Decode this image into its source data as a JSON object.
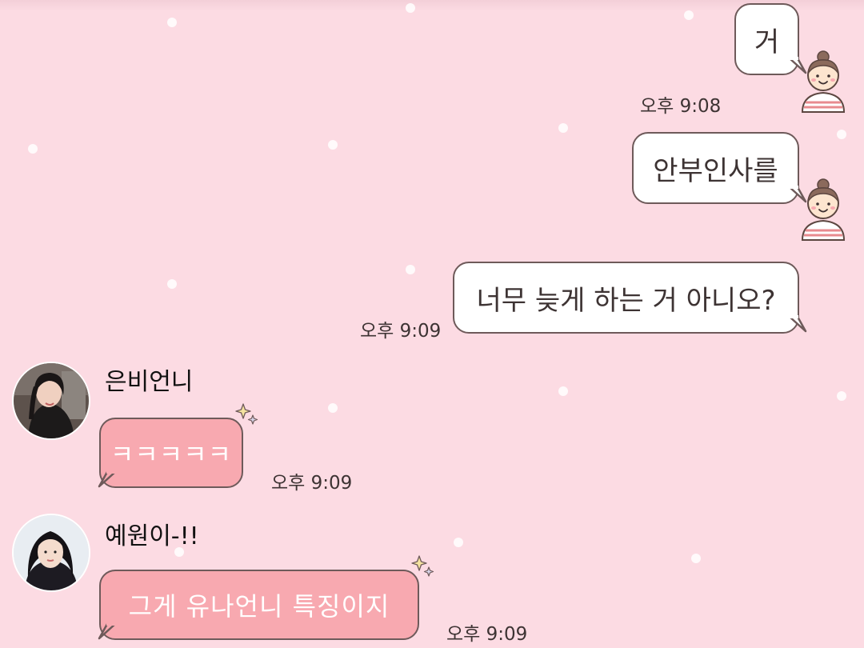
{
  "colors": {
    "background": "#fcdbe3",
    "outgoing_bubble": "#ffffff",
    "incoming_bubble": "#f8a9b0",
    "bubble_border": "#6e5a5a"
  },
  "messages": [
    {
      "direction": "outgoing",
      "text": "거",
      "time": "오후 9:08"
    },
    {
      "direction": "outgoing",
      "text": "안부인사를",
      "time": ""
    },
    {
      "direction": "outgoing",
      "text": "너무 늦게 하는 거 아니오?",
      "time": "오후 9:09"
    },
    {
      "direction": "incoming",
      "sender": "은비언니",
      "avatar": "profile-photo",
      "text": "ㅋㅋㅋㅋㅋ",
      "time": "오후 9:09"
    },
    {
      "direction": "incoming",
      "sender": "예원이-!!",
      "avatar": "profile-photo",
      "text": "그게 유나언니 특징이지",
      "time": "오후 9:09"
    }
  ],
  "icons": {
    "my_avatar": "girl-character-icon",
    "bubble_decoration": "sparkle-icon"
  }
}
